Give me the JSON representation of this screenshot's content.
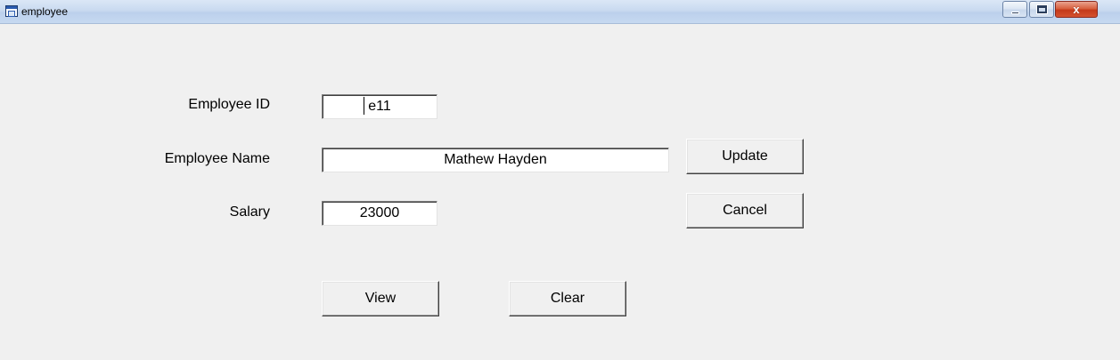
{
  "window": {
    "title": "employee",
    "app_icon": "form-window-icon",
    "controls": {
      "minimize_icon": "minimize-icon",
      "maximize_icon": "maximize-icon",
      "close_icon": "close-icon",
      "close_glyph": "x"
    },
    "colors": {
      "background": "#f0f0f0",
      "titlebar": "#c9daf0",
      "close_button": "#c4391a"
    }
  },
  "form": {
    "employee_id": {
      "label": "Employee ID",
      "value": "e11"
    },
    "employee_name": {
      "label": "Employee Name",
      "value": "Mathew Hayden"
    },
    "salary": {
      "label": "Salary",
      "value": "23000"
    }
  },
  "buttons": {
    "update": "Update",
    "cancel": "Cancel",
    "view": "View",
    "clear": "Clear"
  }
}
